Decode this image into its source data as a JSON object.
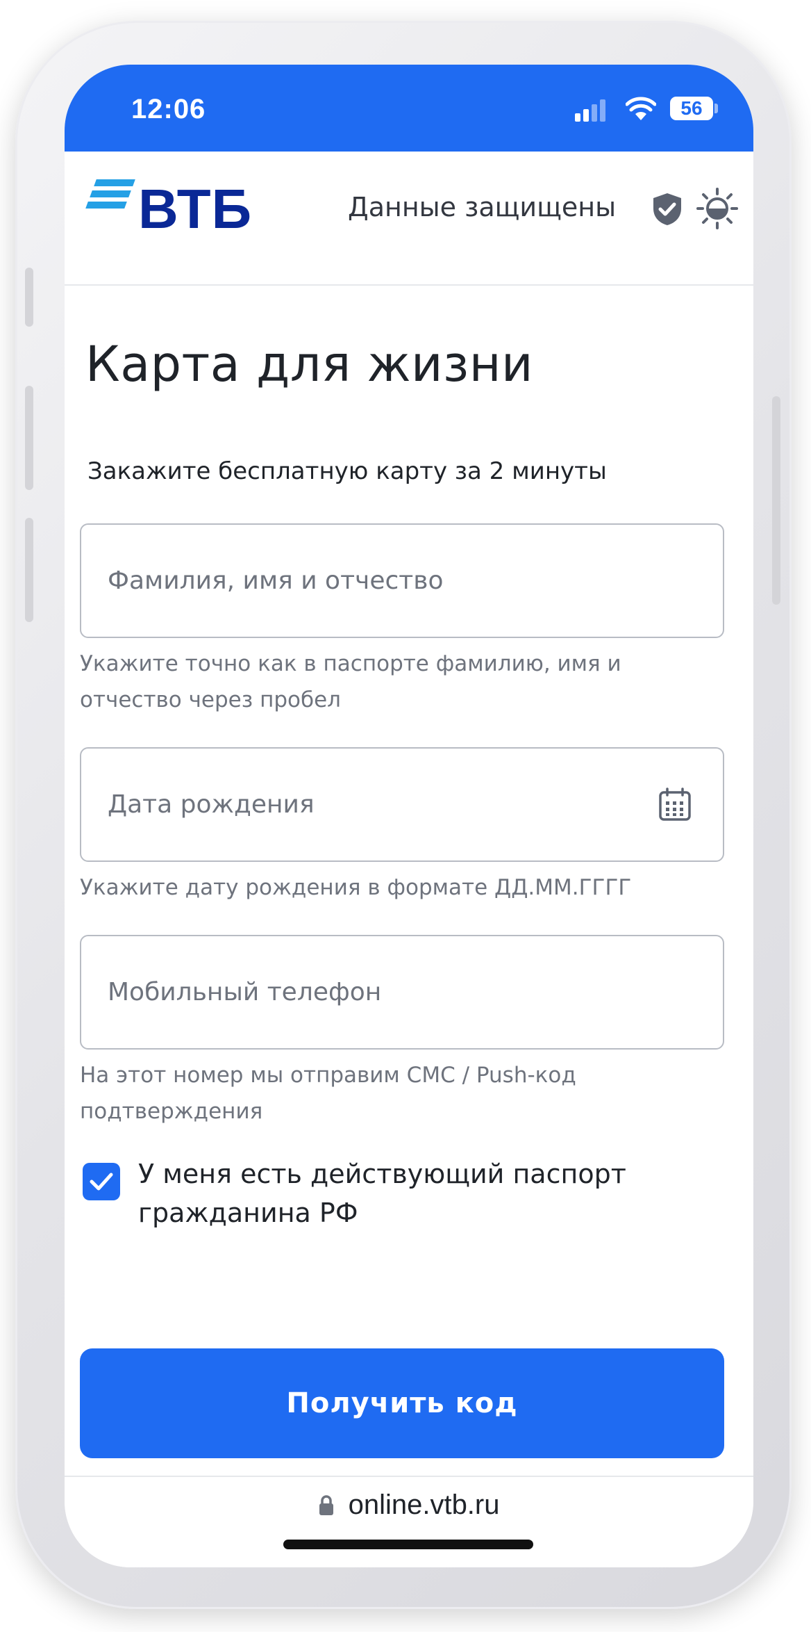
{
  "status_bar": {
    "time": "12:06",
    "battery": "56"
  },
  "header": {
    "logo_text": "ВТБ",
    "secure_label": "Данные защищены"
  },
  "form": {
    "title": "Карта для жизни",
    "subtitle": "Закажите бесплатную карту за 2 минуты",
    "full_name": {
      "placeholder": "Фамилия, имя и отчество",
      "value": "",
      "hint": "Укажите точно как в паспорте фамилию, имя и отчество через пробел"
    },
    "birth_date": {
      "placeholder": "Дата рождения",
      "value": "",
      "hint": "Укажите дату рождения в формате ДД.ММ.ГГГГ"
    },
    "phone": {
      "placeholder": "Мобильный телефон",
      "value": "",
      "hint": "На этот номер мы отправим СМС / Push-код подтверждения"
    },
    "passport_checkbox": {
      "checked": true,
      "label": "У меня есть действующий паспорт гражданина РФ"
    },
    "submit_label": "Получить код"
  },
  "browser": {
    "url": "online.vtb.ru"
  },
  "colors": {
    "accent": "#1f6bf2",
    "brand_dark": "#0a2896",
    "brand_light": "#25a0e5"
  }
}
